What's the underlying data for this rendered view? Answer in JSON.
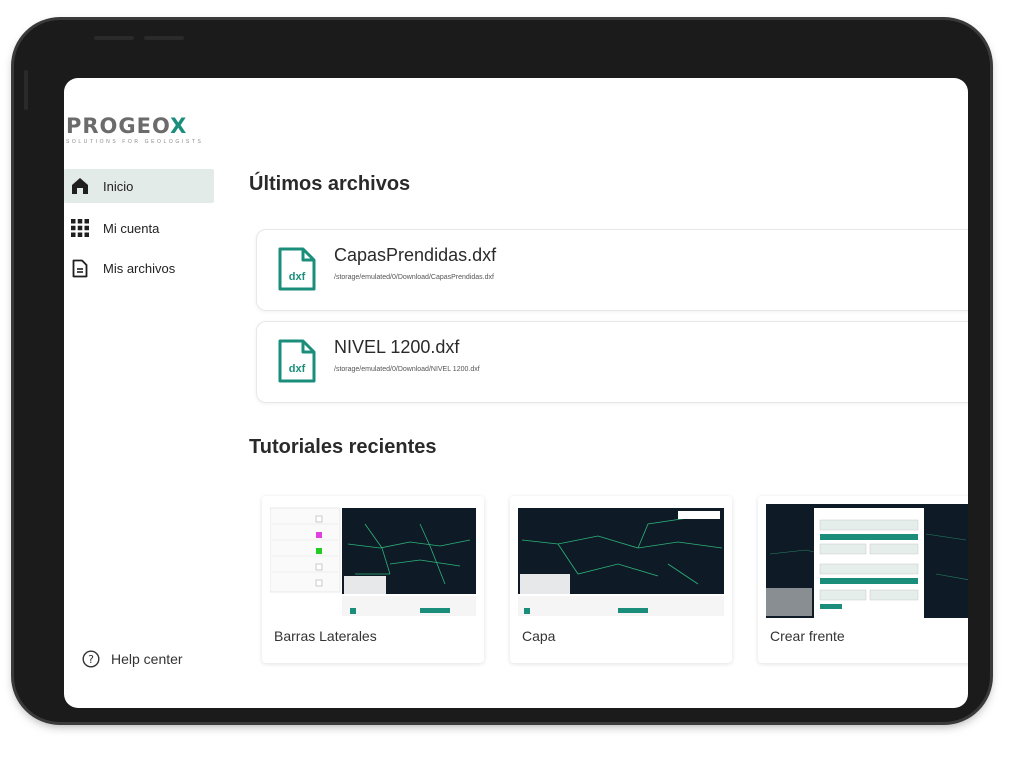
{
  "brand": {
    "name_main": "PROGEO",
    "name_accent": "X",
    "tagline": "SOLUTIONS FOR GEOLOGISTS"
  },
  "sidebar": {
    "items": [
      {
        "label": "Inicio",
        "icon": "home-icon",
        "active": true
      },
      {
        "label": "Mi cuenta",
        "icon": "grid-icon",
        "active": false
      },
      {
        "label": "Mis archivos",
        "icon": "document-icon",
        "active": false
      }
    ],
    "help_label": "Help center",
    "help_icon": "help-circle-icon"
  },
  "main": {
    "recent_files_title": "Últimos archivos",
    "files": [
      {
        "name": "CapasPrendidas.dxf",
        "path": "/storage/emulated/0/Download/CapasPrendidas.dxf",
        "type_badge": "dxf"
      },
      {
        "name": "NIVEL 1200.dxf",
        "path": "/storage/emulated/0/Download/NIVEL 1200.dxf",
        "type_badge": "dxf"
      }
    ],
    "tutorials_title": "Tutoriales recientes",
    "tutorials": [
      {
        "label": "Barras Laterales"
      },
      {
        "label": "Capa"
      },
      {
        "label": "Crear frente"
      }
    ]
  },
  "colors": {
    "accent": "#1b8e7b",
    "active_nav_bg": "#e3ebe9",
    "map_bg": "#0e1b26",
    "map_lines": "#2db37a"
  }
}
